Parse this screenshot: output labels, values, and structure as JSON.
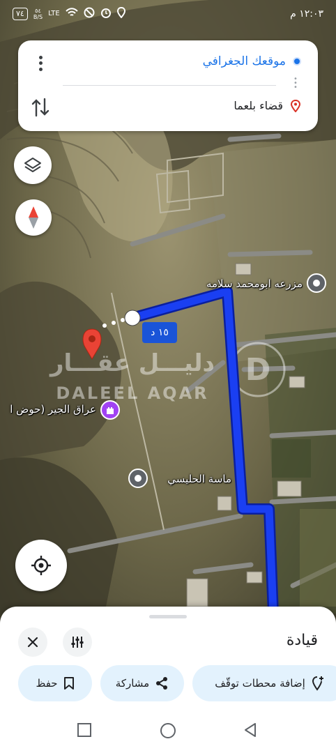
{
  "status": {
    "time": "١٢:٠٣ م",
    "battery": "٧٤",
    "speed": "٥٤\nB/S",
    "network": "LTE"
  },
  "directions": {
    "origin": "موقعك الجغرافي",
    "destination": "قضاء بلعما"
  },
  "map": {
    "route_duration": "١٥ د",
    "labels": {
      "farm": "مزرعه ابومحمد سلامه",
      "irak": "عراق الجير (حوض ا",
      "masa": "ماسة الحليسي"
    },
    "watermark_top": "دليـــل عقـــار",
    "watermark_bottom": "DALEEL AQAR",
    "colors": {
      "route": "#1a3ff2",
      "pin": "#ea4335",
      "poi_gray": "#5f6368",
      "poi_purple": "#a142f4"
    }
  },
  "sheet": {
    "title": "قيادة",
    "chips": {
      "add_stops": "إضافة محطات توقّف",
      "share": "مشاركة",
      "save": "حفظ"
    }
  },
  "icons": [
    "layers-icon",
    "compass-icon",
    "my-location-icon",
    "close-icon",
    "tune-icon",
    "share-icon",
    "bookmark-icon",
    "add-location-icon"
  ]
}
